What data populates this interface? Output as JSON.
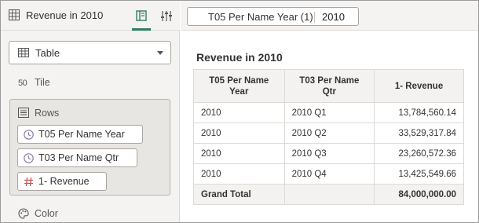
{
  "left_panel": {
    "title": "Revenue in 2010",
    "tabs": [
      {
        "icon": "grammar-panel-icon",
        "active": true
      },
      {
        "icon": "properties-sliders-icon",
        "active": false
      }
    ],
    "viz_type": {
      "label": "Table",
      "icon": "table-grid-icon"
    },
    "tile": {
      "label": "Tile",
      "icon": "tile-50-icon",
      "icon_text": "50"
    },
    "rows": {
      "label": "Rows",
      "items": [
        {
          "label": "T05 Per Name Year",
          "icon": "clock-icon"
        },
        {
          "label": "T03 Per Name Qtr",
          "icon": "clock-icon"
        },
        {
          "label": "1- Revenue",
          "icon": "hash-icon"
        }
      ]
    },
    "color": {
      "label": "Color",
      "icon": "palette-icon"
    }
  },
  "filter_bar": {
    "filter": {
      "name": "T05 Per Name Year (1)",
      "value": "2010"
    }
  },
  "viz": {
    "title": "Revenue in 2010",
    "table": {
      "headers": [
        {
          "line1": "T05 Per Name",
          "line2": "Year"
        },
        {
          "line1": "T03 Per Name",
          "line2": "Qtr"
        },
        {
          "line1": "1- Revenue",
          "line2": ""
        }
      ],
      "rows": [
        [
          "2010",
          "2010 Q1",
          "13,784,560.14"
        ],
        [
          "2010",
          "2010 Q2",
          "33,529,317.84"
        ],
        [
          "2010",
          "2010 Q3",
          "23,260,572.36"
        ],
        [
          "2010",
          "2010 Q4",
          "13,425,549.66"
        ]
      ],
      "total": [
        "Grand Total",
        "",
        "84,000,000.00"
      ]
    }
  },
  "colors": {
    "accent": "#2e7d65",
    "pill_icon": "#8a7fa8",
    "hash_icon": "#c0504d",
    "panel_bg": "#f4f3f1"
  }
}
